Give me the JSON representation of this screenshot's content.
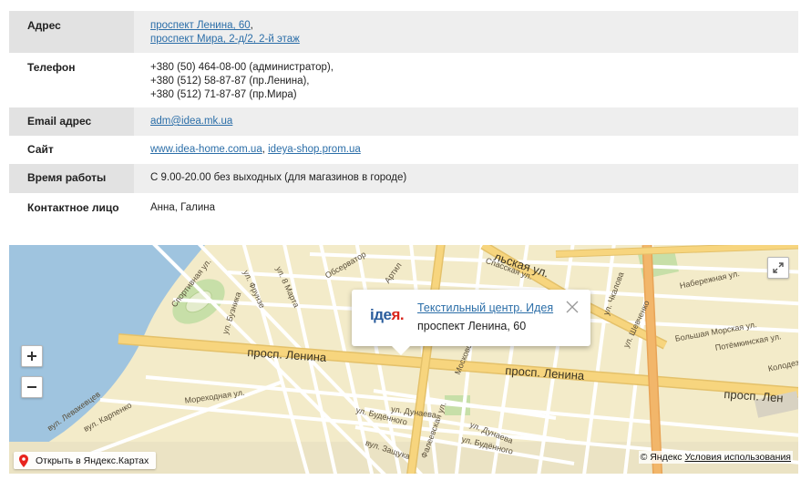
{
  "contacts": {
    "address": {
      "label": "Адрес",
      "line1": "проспект Ленина, 60",
      "line1_suffix": ",",
      "line2": "проспект Мира, 2-д/2, 2-й этаж"
    },
    "phone": {
      "label": "Телефон",
      "lines": [
        "+380 (50) 464-08-00 (администратор),",
        "+380 (512) 58-87-87 (пр.Ленина),",
        "+380 (512) 71-87-87 (пр.Мира)"
      ]
    },
    "email": {
      "label": "Email адрес",
      "value": "adm@idea.mk.ua"
    },
    "site": {
      "label": "Сайт",
      "link1": "www.idea-home.com.ua",
      "separator": ", ",
      "link2": "ideya-shop.prom.ua"
    },
    "hours": {
      "label": "Время работы",
      "value": "С 9.00-20.00 без выходных (для магазинов в городе)"
    },
    "person": {
      "label": "Контактное лицо",
      "value": "Анна, Галина"
    }
  },
  "map": {
    "balloon": {
      "logo_main": "iде",
      "logo_accent": "я.",
      "title": "Текстильный центр. Идея",
      "address": "проспект Ленина, 60"
    },
    "streets": [
      "Набережная ул.",
      "Большая Морская ул.",
      "Потёмкинская ул.",
      "Колодез",
      "просп. Ленина",
      "просп. Ленина",
      "просп. Лен",
      "ул. Дунаева",
      "ул. Будённого",
      "ул. Фрунзе",
      "ул. 8 Марта",
      "ул. Бузника",
      "Спортивная ул.",
      "Обсерватор",
      "Артил",
      "Спасская ул.",
      "Московская ул.",
      "Мореходная ул.",
      "вул. Левакевцев",
      "вул. Карпенко",
      "вул. Защука",
      "Фалеевская ул.",
      "ул. Будённого",
      "ул. Дунаева",
      "Садовая ул.",
      "Белая ул.",
      "ул. Шевченко",
      "льская ул.",
      "ул. Чкалова"
    ],
    "open_label": "Открыть в Яндекс.Картах",
    "copyright_prefix": "© Яндекс",
    "terms_link": "Условия использования",
    "zoom_in": "+",
    "zoom_out": "−",
    "colors": {
      "land": "#f3ebc9",
      "water": "#9fc4df",
      "major_road": "#f7d57e",
      "avenue": "#f2b66a",
      "park": "#c7dfa8"
    }
  }
}
